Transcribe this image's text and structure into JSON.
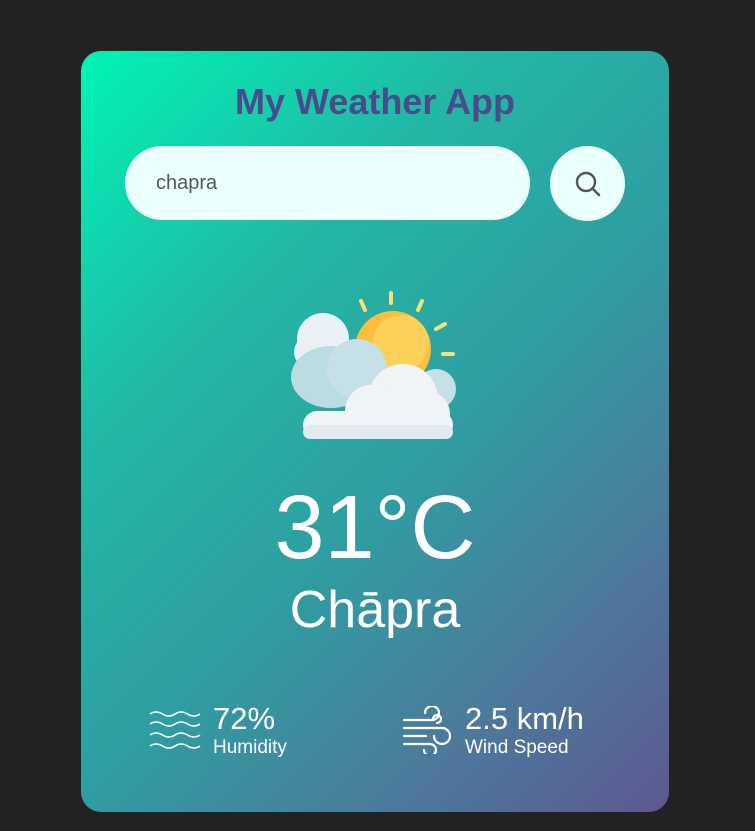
{
  "app": {
    "title": "My Weather App"
  },
  "search": {
    "value": "chapra",
    "button_icon": "search-icon"
  },
  "weather": {
    "condition_icon": "partly-cloudy-icon",
    "temperature": "31°C",
    "city": "Chāpra"
  },
  "details": {
    "humidity": {
      "icon": "humidity-waves-icon",
      "value": "72%",
      "label": "Humidity"
    },
    "wind": {
      "icon": "wind-icon",
      "value": "2.5 km/h",
      "label": "Wind Speed"
    }
  },
  "colors": {
    "background": "#222222",
    "title": "#4a4b8c",
    "input_bg": "#ebfffc",
    "gradient_start": "#00f5b4",
    "gradient_end": "#5d5890"
  }
}
